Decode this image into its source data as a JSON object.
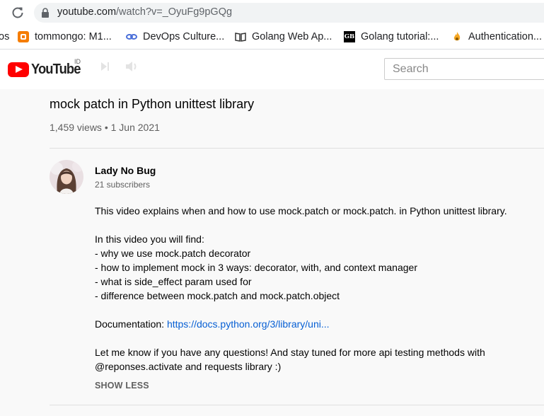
{
  "browser": {
    "url_host": "youtube.com",
    "url_path": "/watch?v=_OyuFg9pGQg",
    "bookmarks": [
      {
        "label": "os",
        "icon": "none"
      },
      {
        "label": "tommongo: M1...",
        "icon": "blogger-icon"
      },
      {
        "label": "DevOps Culture...",
        "icon": "link-icon"
      },
      {
        "label": "Golang Web Ap...",
        "icon": "book-icon"
      },
      {
        "label": "Golang tutorial:...",
        "icon": "gb-icon"
      },
      {
        "label": "Authentication...",
        "icon": "flame-icon"
      }
    ]
  },
  "masthead": {
    "logo_text": "YouTube",
    "region": "ID",
    "search_placeholder": "Search"
  },
  "video": {
    "title": "mock patch in Python unittest library",
    "views": "1,459 views",
    "separator": "•",
    "date": "1 Jun 2021"
  },
  "channel": {
    "name": "Lady No Bug",
    "subscribers": "21 subscribers"
  },
  "description": {
    "intro": "This video explains when and how to use mock.patch or mock.patch. in Python unittest library.",
    "list_heading": "In this video you will find:",
    "bullets": [
      "- why we use mock.patch decorator",
      "- how to implement mock in 3 ways: decorator, with, and context manager",
      "- what is side_effect param used for",
      "- difference between mock.patch and mock.patch.object"
    ],
    "doc_label": "Documentation: ",
    "doc_link": "https://docs.python.org/3/library/uni...",
    "closing_1": "Let me know if you have any questions! And stay tuned for more api testing methods with",
    "closing_2": "@reponses.activate and requests library :)",
    "show_less": "SHOW LESS"
  }
}
